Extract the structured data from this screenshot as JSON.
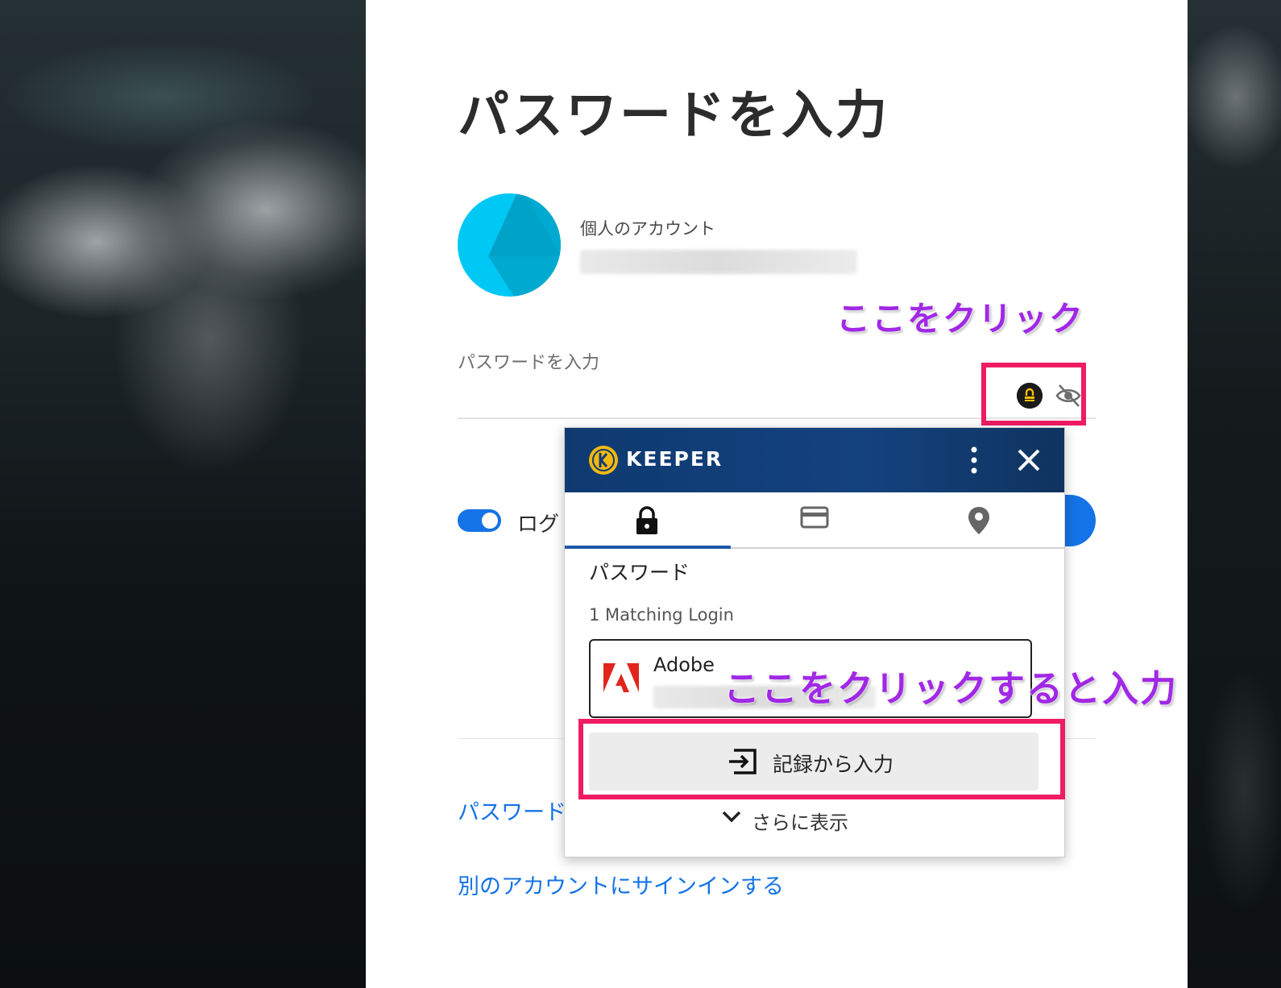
{
  "page": {
    "title": "パスワードを入力",
    "account_label": "個人のアカウント",
    "password_label": "パスワードを入力",
    "remember_text": "ログ",
    "forgot_link": "パスワード",
    "switch_account_link": "別のアカウントにサインインする"
  },
  "keeper": {
    "brand": "KEEPER",
    "section_title": "パスワード",
    "matching": "1 Matching Login",
    "record_title": "Adobe",
    "fill_button": "記録から入力",
    "show_more": "さらに表示"
  },
  "annotations": {
    "click_here": "ここをクリック",
    "click_to_fill": "ここをクリックすると入力"
  },
  "colors": {
    "accent_blue": "#1473e6",
    "keeper_header": "#14427e",
    "highlight": "#ef1b63",
    "annotation_text": "#a128e6"
  }
}
